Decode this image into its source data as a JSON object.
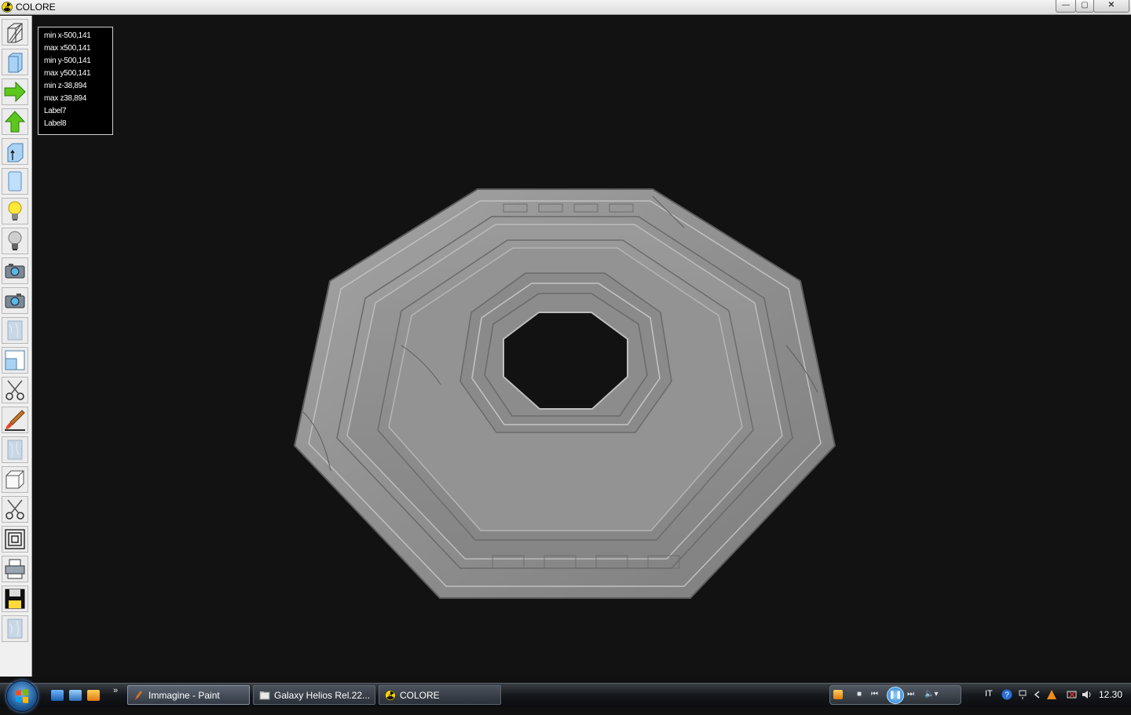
{
  "window": {
    "title": "COLORE",
    "minimize_glyph": "—",
    "maximize_glyph": "▢",
    "close_glyph": "✕"
  },
  "toolbar": {
    "tools": [
      {
        "icon": "wireframe-cube-icon"
      },
      {
        "icon": "blue-cube-icon"
      },
      {
        "icon": "arrow-right-icon"
      },
      {
        "icon": "arrow-up-icon"
      },
      {
        "icon": "cube-arrow-icon"
      },
      {
        "icon": "blue-slab-icon"
      },
      {
        "icon": "light-bulb-on-icon"
      },
      {
        "icon": "light-bulb-off-icon"
      },
      {
        "icon": "camera-icon"
      },
      {
        "icon": "camera-alt-icon"
      },
      {
        "icon": "texture-icon"
      },
      {
        "icon": "viewport-icon"
      },
      {
        "icon": "scissors-icon"
      },
      {
        "icon": "brush-icon"
      },
      {
        "icon": "texture-alt-icon"
      },
      {
        "icon": "white-cube-icon"
      },
      {
        "icon": "scissors-alt-icon"
      },
      {
        "icon": "concentric-squares-icon"
      },
      {
        "icon": "printer-icon"
      },
      {
        "icon": "floppy-disk-icon"
      },
      {
        "icon": "texture-small-icon"
      }
    ]
  },
  "info_panel": {
    "lines": [
      "min x-500,141",
      "max x500,141",
      "min y-500,141",
      "max y500,141",
      "min z-38,894",
      "max z38,894",
      "Label7",
      "Label8"
    ]
  },
  "taskbar": {
    "quick_launch_chevron": "»",
    "tasks": [
      {
        "label": "Immagine - Paint",
        "icon": "paint-icon"
      },
      {
        "label": "Galaxy Helios  Rel.22...",
        "icon": "folder-icon"
      },
      {
        "label": "COLORE",
        "icon": "radiation-icon"
      }
    ],
    "media": {
      "stop": "■",
      "prev": "⏮",
      "play": "❚❚",
      "next": "⏭",
      "volume": "🔈▾"
    },
    "tray_language": "IT",
    "clock": "12.30"
  },
  "colors": {
    "viewport_bg": "#121212",
    "marble": "#8e8e8e",
    "taskbar": "#1a1d21"
  }
}
